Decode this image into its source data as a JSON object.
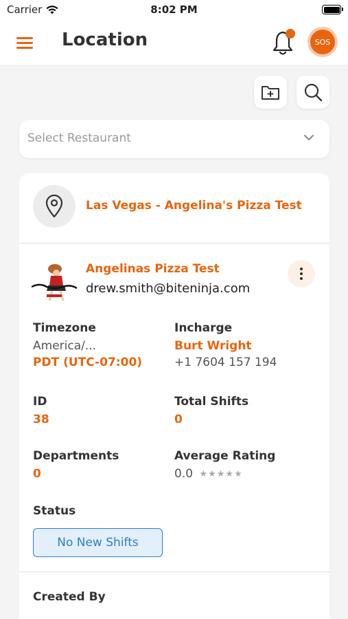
{
  "status_bar": {
    "carrier": "Carrier",
    "time": "8:02 PM"
  },
  "header": {
    "title": "Location",
    "sos_label": "SOS"
  },
  "actions": {
    "add_folder_icon": "folder-plus-icon",
    "search_icon": "search-icon"
  },
  "select": {
    "placeholder": "Select Restaurant"
  },
  "location": {
    "name": "Las Vegas - Angelina's Pizza Test",
    "business_name": "Angelinas Pizza Test",
    "email": "drew.smith@biteninja.com",
    "timezone_label": "Timezone",
    "timezone_value": "America/...",
    "timezone_offset": "PDT (UTC-07:00)",
    "incharge_label": "Incharge",
    "incharge_name": "Burt Wright",
    "incharge_phone": "+1 7604 157 194",
    "id_label": "ID",
    "id_value": "38",
    "total_shifts_label": "Total Shifts",
    "total_shifts_value": "0",
    "departments_label": "Departments",
    "departments_value": "0",
    "avg_rating_label": "Average Rating",
    "avg_rating_value": "0.0",
    "avg_rating_stars": "★★★★★",
    "status_label": "Status",
    "status_value": "No New Shifts",
    "created_by_label": "Created By"
  },
  "colors": {
    "accent": "#e8650f",
    "status_blue": "#2e7fc1",
    "status_bg": "#e3f0fb"
  }
}
